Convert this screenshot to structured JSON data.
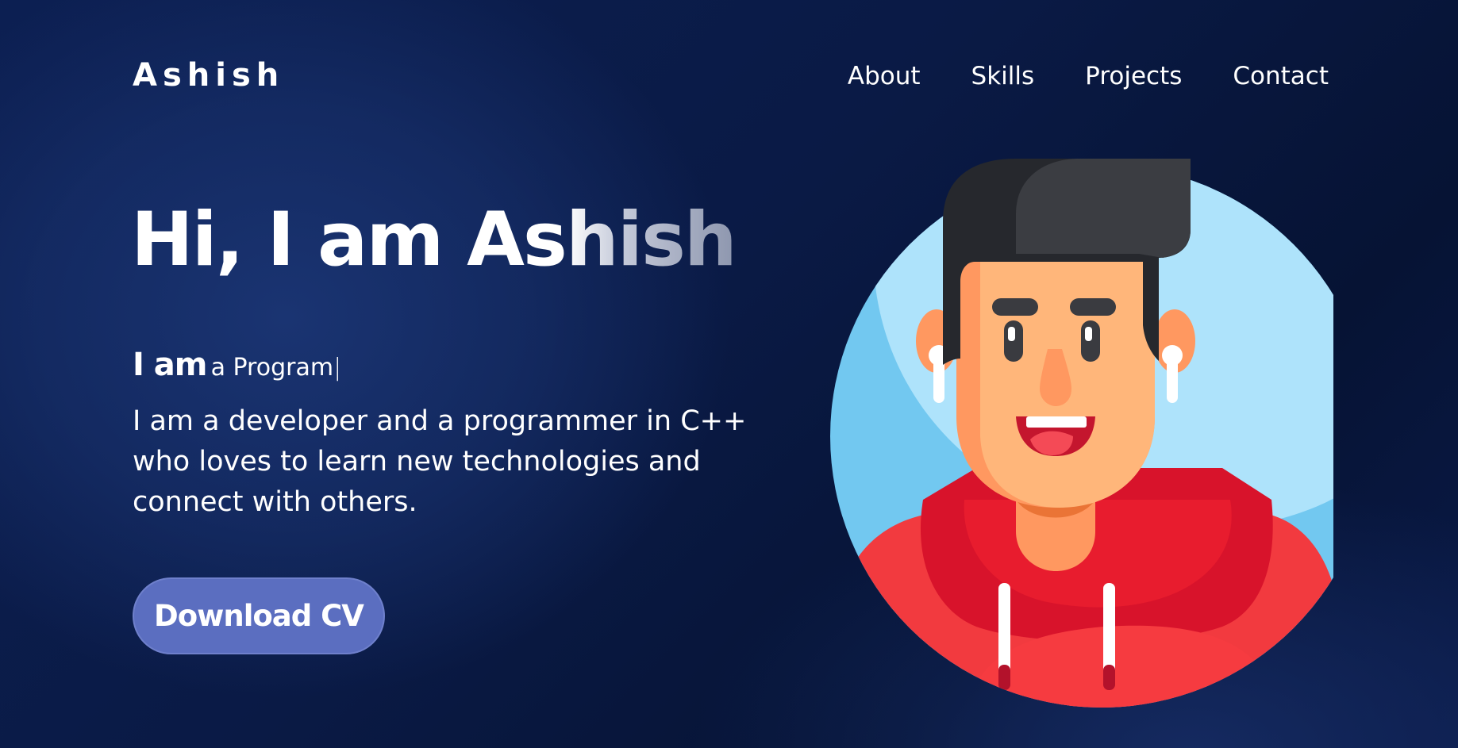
{
  "header": {
    "logo": "Ashish",
    "nav": [
      "About",
      "Skills",
      "Projects",
      "Contact"
    ]
  },
  "hero": {
    "greeting_plain": "Hi, I am As",
    "greeting_faded": "hish",
    "typing_lead": "I am",
    "typing_word": "a Program",
    "typing_cursor": "|",
    "description": "I am a developer and a programmer in C++ who loves to learn new technologies and connect with others.",
    "cta_label": "Download CV"
  },
  "colors": {
    "background": "#0c1f52",
    "button": "#5b6ec0",
    "avatar_circle": "#aee3fb",
    "hoodie": "#f23a3f"
  }
}
